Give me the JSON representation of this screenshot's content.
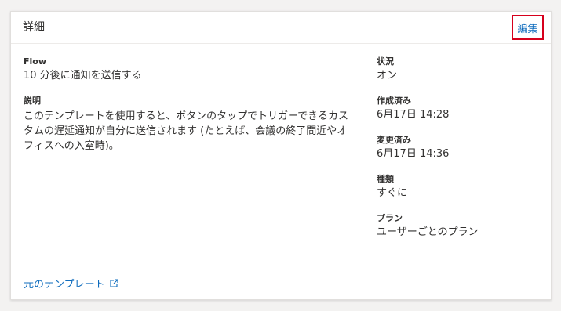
{
  "header": {
    "title": "詳細",
    "edit_label": "編集"
  },
  "details": {
    "flow": {
      "label": "Flow",
      "value": "10 分後に通知を送信する"
    },
    "description": {
      "label": "説明",
      "value": "このテンプレートを使用すると、ボタンのタップでトリガーできるカスタムの遅延通知が自分に送信されます (たとえば、会議の終了間近やオフィスへの入室時)。"
    },
    "status": {
      "label": "状況",
      "value": "オン"
    },
    "created": {
      "label": "作成済み",
      "value": "6月17日 14:28"
    },
    "modified": {
      "label": "変更済み",
      "value": "6月17日 14:36"
    },
    "type": {
      "label": "種類",
      "value": "すぐに"
    },
    "plan": {
      "label": "プラン",
      "value": "ユーザーごとのプラン"
    }
  },
  "footer": {
    "template_link": "元のテンプレート",
    "template_link_icon": "external-link-icon"
  },
  "colors": {
    "accent": "#0f6cbd",
    "highlight_border": "#d6001c"
  }
}
